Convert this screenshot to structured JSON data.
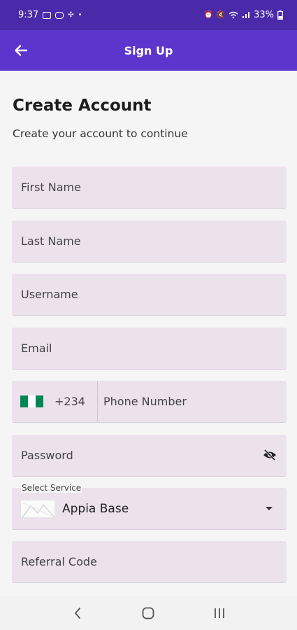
{
  "status_bar": {
    "time": "9:37",
    "battery": "33%",
    "icons_left": [
      "youtube-icon",
      "instagram-icon",
      "fan-icon",
      "dot-icon"
    ],
    "icons_right": [
      "alarm-icon",
      "mute-icon",
      "wifi-icon",
      "signal-icon",
      "battery-icon"
    ]
  },
  "app_bar": {
    "title": "Sign Up",
    "back_icon": "arrow-left-icon"
  },
  "header": {
    "title": "Create Account",
    "subtitle": "Create your account to continue"
  },
  "form": {
    "first_name": {
      "placeholder": "First Name"
    },
    "last_name": {
      "placeholder": "Last Name"
    },
    "username": {
      "placeholder": "Username"
    },
    "email": {
      "placeholder": "Email"
    },
    "phone": {
      "country_code": "+234",
      "flag": "nigeria-flag",
      "placeholder": "Phone Number"
    },
    "password": {
      "placeholder": "Password",
      "toggle_icon": "eye-off-icon"
    },
    "service": {
      "label": "Select Service",
      "value": "Appia Base"
    },
    "referral": {
      "placeholder": "Referral Code"
    }
  },
  "nav": {
    "back_icon": "nav-back-icon",
    "home_icon": "nav-home-icon",
    "recents_icon": "nav-recents-icon"
  },
  "colors": {
    "status_bar": "#4a2aa8",
    "app_bar": "#5c35cc",
    "field_bg": "#ebe2ec",
    "page_bg": "#f5f5f5"
  }
}
